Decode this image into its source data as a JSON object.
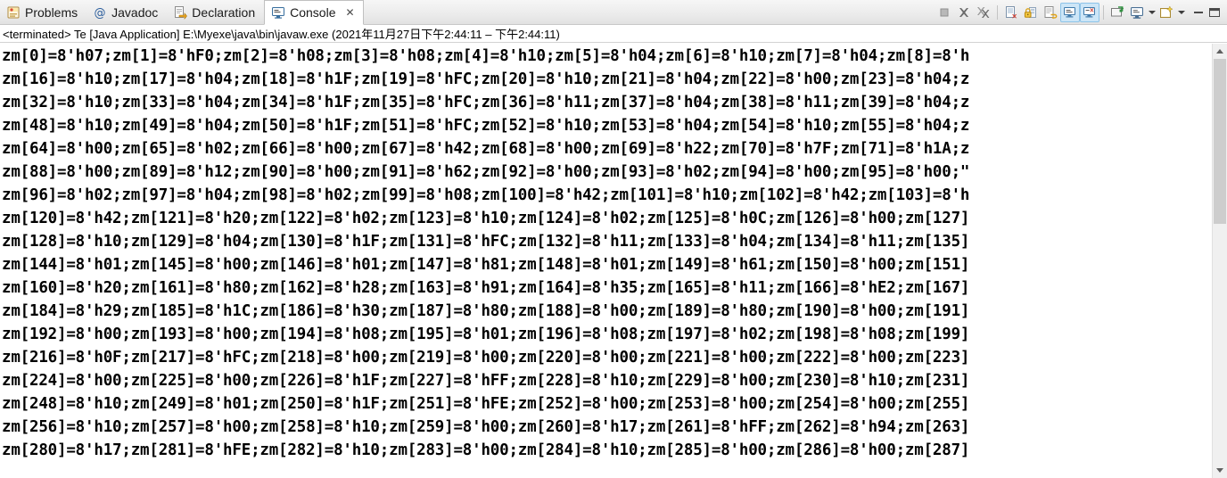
{
  "window": {
    "tabs": [
      {
        "label": "Problems",
        "icon": "problems-icon",
        "active": false
      },
      {
        "label": "Javadoc",
        "icon": "javadoc-icon",
        "active": false
      },
      {
        "label": "Declaration",
        "icon": "declaration-icon",
        "active": false
      },
      {
        "label": "Console",
        "icon": "console-icon",
        "active": true,
        "close": "✕"
      }
    ],
    "toolbar": [
      {
        "name": "terminate-button",
        "icon": "terminate-icon",
        "toggled": false
      },
      {
        "name": "remove-launch-button",
        "icon": "remove-launch-icon",
        "toggled": false
      },
      {
        "name": "remove-all-terminated-button",
        "icon": "remove-all-terminated-icon",
        "toggled": false
      },
      {
        "name": "separator-1",
        "icon": "separator",
        "toggled": false
      },
      {
        "name": "clear-console-button",
        "icon": "clear-console-icon",
        "toggled": false
      },
      {
        "name": "scroll-lock-button",
        "icon": "scroll-lock-icon",
        "toggled": false
      },
      {
        "name": "word-wrap-button",
        "icon": "word-wrap-icon",
        "toggled": false
      },
      {
        "name": "show-console-on-output-button",
        "icon": "show-console-output-icon",
        "toggled": true
      },
      {
        "name": "show-console-on-error-button",
        "icon": "show-console-error-icon",
        "toggled": true
      },
      {
        "name": "separator-2",
        "icon": "separator",
        "toggled": false
      },
      {
        "name": "pin-console-button",
        "icon": "pin-console-icon",
        "toggled": false
      },
      {
        "name": "display-selected-console-button",
        "icon": "display-console-icon",
        "toggled": false
      },
      {
        "name": "display-selected-console-menu",
        "icon": "chevron-down-icon",
        "toggled": false
      },
      {
        "name": "open-console-button",
        "icon": "open-console-icon",
        "toggled": false
      },
      {
        "name": "open-console-menu",
        "icon": "chevron-down-icon",
        "toggled": false
      },
      {
        "name": "minimize-view-button",
        "icon": "minimize-icon",
        "toggled": false
      },
      {
        "name": "maximize-view-button",
        "icon": "maximize-icon",
        "toggled": false
      }
    ],
    "status_line": "<terminated> Te [Java Application] E:\\Myexe\\java\\bin\\javaw.exe  (2021年11月27日下午2:44:11 – 下午2:44:11)"
  },
  "console": {
    "lines": [
      "zm[0]=8'h07;zm[1]=8'hF0;zm[2]=8'h08;zm[3]=8'h08;zm[4]=8'h10;zm[5]=8'h04;zm[6]=8'h10;zm[7]=8'h04;zm[8]=8'h",
      "zm[16]=8'h10;zm[17]=8'h04;zm[18]=8'h1F;zm[19]=8'hFC;zm[20]=8'h10;zm[21]=8'h04;zm[22]=8'h00;zm[23]=8'h04;z",
      "zm[32]=8'h10;zm[33]=8'h04;zm[34]=8'h1F;zm[35]=8'hFC;zm[36]=8'h11;zm[37]=8'h04;zm[38]=8'h11;zm[39]=8'h04;z",
      "zm[48]=8'h10;zm[49]=8'h04;zm[50]=8'h1F;zm[51]=8'hFC;zm[52]=8'h10;zm[53]=8'h04;zm[54]=8'h10;zm[55]=8'h04;z",
      "zm[64]=8'h00;zm[65]=8'h02;zm[66]=8'h00;zm[67]=8'h42;zm[68]=8'h00;zm[69]=8'h22;zm[70]=8'h7F;zm[71]=8'h1A;z",
      "zm[88]=8'h00;zm[89]=8'h12;zm[90]=8'h00;zm[91]=8'h62;zm[92]=8'h00;zm[93]=8'h02;zm[94]=8'h00;zm[95]=8'h00;\"",
      "zm[96]=8'h02;zm[97]=8'h04;zm[98]=8'h02;zm[99]=8'h08;zm[100]=8'h42;zm[101]=8'h10;zm[102]=8'h42;zm[103]=8'h",
      "zm[120]=8'h42;zm[121]=8'h20;zm[122]=8'h02;zm[123]=8'h10;zm[124]=8'h02;zm[125]=8'h0C;zm[126]=8'h00;zm[127]",
      "zm[128]=8'h10;zm[129]=8'h04;zm[130]=8'h1F;zm[131]=8'hFC;zm[132]=8'h11;zm[133]=8'h04;zm[134]=8'h11;zm[135]",
      "zm[144]=8'h01;zm[145]=8'h00;zm[146]=8'h01;zm[147]=8'h81;zm[148]=8'h01;zm[149]=8'h61;zm[150]=8'h00;zm[151]",
      "zm[160]=8'h20;zm[161]=8'h80;zm[162]=8'h28;zm[163]=8'h91;zm[164]=8'h35;zm[165]=8'h11;zm[166]=8'hE2;zm[167]",
      "zm[184]=8'h29;zm[185]=8'h1C;zm[186]=8'h30;zm[187]=8'h80;zm[188]=8'h00;zm[189]=8'h80;zm[190]=8'h00;zm[191]",
      "zm[192]=8'h00;zm[193]=8'h00;zm[194]=8'h08;zm[195]=8'h01;zm[196]=8'h08;zm[197]=8'h02;zm[198]=8'h08;zm[199]",
      "zm[216]=8'h0F;zm[217]=8'hFC;zm[218]=8'h00;zm[219]=8'h00;zm[220]=8'h00;zm[221]=8'h00;zm[222]=8'h00;zm[223]",
      "zm[224]=8'h00;zm[225]=8'h00;zm[226]=8'h1F;zm[227]=8'hFF;zm[228]=8'h10;zm[229]=8'h00;zm[230]=8'h10;zm[231]",
      "zm[248]=8'h10;zm[249]=8'h01;zm[250]=8'h1F;zm[251]=8'hFE;zm[252]=8'h00;zm[253]=8'h00;zm[254]=8'h00;zm[255]",
      "zm[256]=8'h10;zm[257]=8'h00;zm[258]=8'h10;zm[259]=8'h00;zm[260]=8'h17;zm[261]=8'hFF;zm[262]=8'h94;zm[263]",
      "zm[280]=8'h17;zm[281]=8'hFE;zm[282]=8'h10;zm[283]=8'h00;zm[284]=8'h10;zm[285]=8'h00;zm[286]=8'h00;zm[287]"
    ]
  },
  "colors": {
    "toggle_highlight": "#cde6f7",
    "tab_active_bg": "#ffffff",
    "text": "#000000",
    "scrollbar_thumb": "#cdcdcd"
  }
}
